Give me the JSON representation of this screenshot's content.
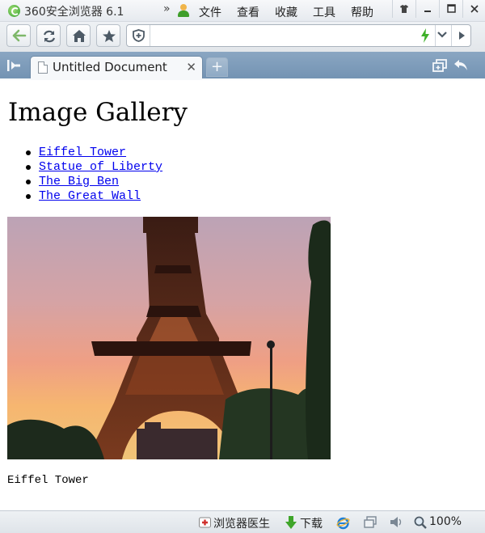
{
  "window": {
    "app_title": "360安全浏览器 6.1",
    "menu": [
      "文件",
      "查看",
      "收藏",
      "工具",
      "帮助"
    ]
  },
  "toolbar": {
    "address_value": "",
    "icons": [
      "back-arrow-icon",
      "refresh-icon",
      "home-icon",
      "star-icon",
      "shield-icon",
      "lightning-icon",
      "chevron-down-icon",
      "play-icon"
    ]
  },
  "tabs": [
    {
      "label": "Untitled Document",
      "active": true
    }
  ],
  "page": {
    "heading": "Image Gallery",
    "links": [
      "Eiffel Tower",
      "Statue of Liberty",
      "The Big Ben",
      "The Great Wall"
    ],
    "caption": "Eiffel Tower"
  },
  "status": {
    "doctor": "浏览器医生",
    "download": "下载",
    "zoom": "100%"
  },
  "colors": {
    "tabstrip": "#7f9dbb",
    "link": "#0000ee",
    "accent_green": "#3f9e2a"
  }
}
